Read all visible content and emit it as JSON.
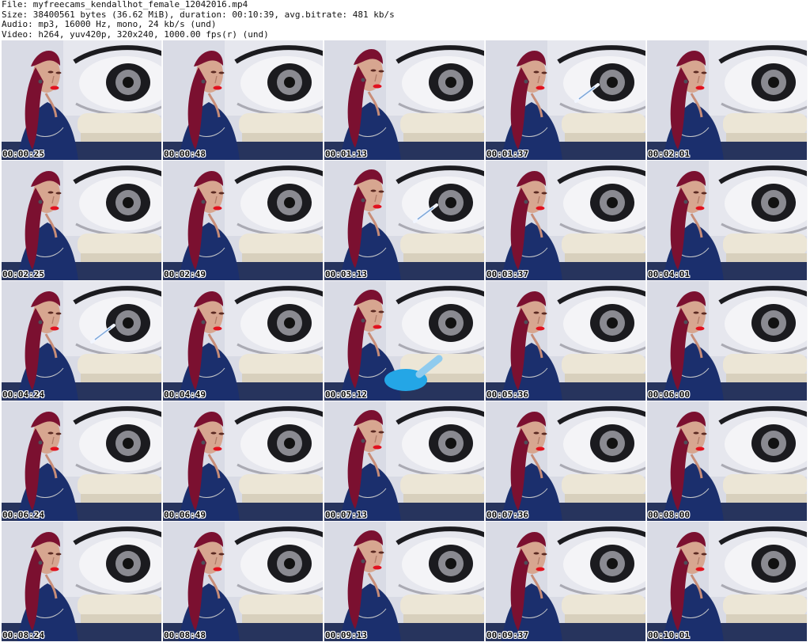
{
  "header": {
    "file_line": "File: myfreecams_kendallhot_female_12042016.mp4",
    "size_line": "Size: 38400561 bytes (36.62 MiB), duration: 00:10:39, avg.bitrate: 481 kb/s",
    "audio_line": "Audio: mp3, 16000 Hz, mono, 24 kb/s (und)",
    "video_line": "Video: h264, yuv420p, 320x240, 1000.00 fps(r) (und)"
  },
  "thumbnails": [
    {
      "time": "00:00:25",
      "prop": ""
    },
    {
      "time": "00:00:48",
      "prop": ""
    },
    {
      "time": "00:01:13",
      "prop": ""
    },
    {
      "time": "00:01:37",
      "prop": "vape"
    },
    {
      "time": "00:02:01",
      "prop": ""
    },
    {
      "time": "00:02:25",
      "prop": ""
    },
    {
      "time": "00:02:49",
      "prop": ""
    },
    {
      "time": "00:03:13",
      "prop": "vape"
    },
    {
      "time": "00:03:37",
      "prop": ""
    },
    {
      "time": "00:04:01",
      "prop": ""
    },
    {
      "time": "00:04:24",
      "prop": "vape"
    },
    {
      "time": "00:04:49",
      "prop": ""
    },
    {
      "time": "00:05:12",
      "prop": "blue-object"
    },
    {
      "time": "00:05:36",
      "prop": ""
    },
    {
      "time": "00:06:00",
      "prop": ""
    },
    {
      "time": "00:06:24",
      "prop": ""
    },
    {
      "time": "00:06:49",
      "prop": ""
    },
    {
      "time": "00:07:13",
      "prop": ""
    },
    {
      "time": "00:07:36",
      "prop": ""
    },
    {
      "time": "00:08:00",
      "prop": ""
    },
    {
      "time": "00:08:24",
      "prop": ""
    },
    {
      "time": "00:08:48",
      "prop": ""
    },
    {
      "time": "00:09:13",
      "prop": ""
    },
    {
      "time": "00:09:37",
      "prop": ""
    },
    {
      "time": "00:10:01",
      "prop": ""
    }
  ],
  "colors": {
    "background": "#ffffff",
    "wall": "#d9dbe5",
    "hair": "#7b1030",
    "skin": "#d7a690",
    "shirt": "#1b2f6d",
    "couch": "#ece6d6",
    "eye_dark": "#1b1b1f",
    "prop_blue": "#24a6e6"
  }
}
